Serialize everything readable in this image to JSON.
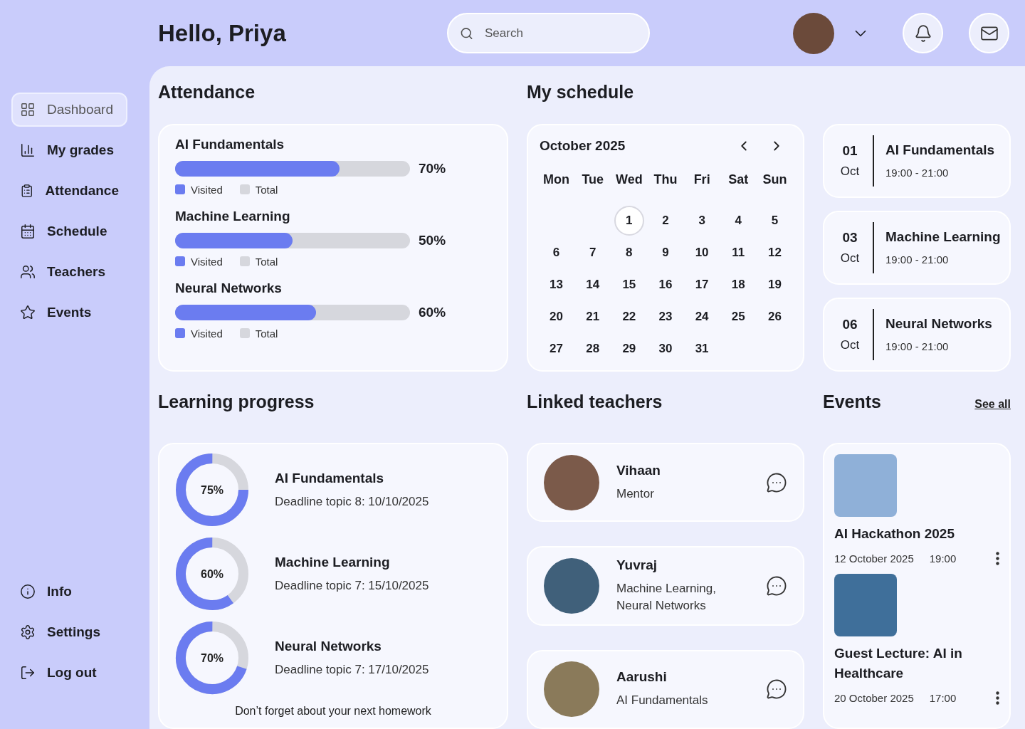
{
  "header": {
    "greeting": "Hello, Priya",
    "search": {
      "placeholder": "Search"
    }
  },
  "sidebar": {
    "items": [
      {
        "label": "Dashboard",
        "selected": true
      },
      {
        "label": "My grades",
        "selected": false
      },
      {
        "label": "Attendance",
        "selected": false
      },
      {
        "label": "Schedule",
        "selected": false
      },
      {
        "label": "Teachers",
        "selected": false
      },
      {
        "label": "Events",
        "selected": false
      }
    ],
    "bottom_items": [
      {
        "label": "Info"
      },
      {
        "label": "Settings"
      },
      {
        "label": "Log out"
      }
    ]
  },
  "attendance": {
    "title": "Attendance",
    "courses": [
      {
        "name": "AI Fundamentals",
        "level": 0.7,
        "percent": "70%",
        "legend": [
          "Visited",
          "Total"
        ]
      },
      {
        "name": "Machine Learning",
        "level": 0.5,
        "percent": "50%",
        "legend": [
          "Visited",
          "Total"
        ]
      },
      {
        "name": "Neural Networks",
        "level": 0.6,
        "percent": "60%",
        "legend": [
          "Visited",
          "Total"
        ]
      }
    ]
  },
  "schedule": {
    "title": "My schedule",
    "month": "October 2025",
    "weekdays": [
      "Mon",
      "Tue",
      "Wed",
      "Thu",
      "Fri",
      "Sat",
      "Sun"
    ],
    "weeks": [
      {
        "days": [
          {
            "day": "1",
            "selected": true
          },
          {
            "day": "2",
            "selected": false
          },
          {
            "day": "3",
            "selected": false
          },
          {
            "day": "4",
            "selected": false
          },
          {
            "day": "5",
            "selected": false
          }
        ]
      },
      {
        "days": [
          {
            "day": "6",
            "selected": false
          },
          {
            "day": "7",
            "selected": false
          },
          {
            "day": "8",
            "selected": false
          },
          {
            "day": "9",
            "selected": false
          },
          {
            "day": "10",
            "selected": false
          },
          {
            "day": "11",
            "selected": false
          },
          {
            "day": "12",
            "selected": false
          }
        ]
      },
      {
        "days": [
          {
            "day": "13",
            "selected": false
          },
          {
            "day": "14",
            "selected": false
          },
          {
            "day": "15",
            "selected": false
          },
          {
            "day": "16",
            "selected": false
          },
          {
            "day": "17",
            "selected": false
          },
          {
            "day": "18",
            "selected": false
          },
          {
            "day": "19",
            "selected": false
          }
        ]
      },
      {
        "days": [
          {
            "day": "20",
            "selected": false
          },
          {
            "day": "21",
            "selected": false
          },
          {
            "day": "22",
            "selected": false
          },
          {
            "day": "23",
            "selected": false
          },
          {
            "day": "24",
            "selected": false
          },
          {
            "day": "25",
            "selected": false
          },
          {
            "day": "26",
            "selected": false
          }
        ]
      },
      {
        "days": [
          {
            "day": "27",
            "selected": false
          },
          {
            "day": "28",
            "selected": false
          },
          {
            "day": "29",
            "selected": false
          },
          {
            "day": "30",
            "selected": false
          },
          {
            "day": "31",
            "selected": false
          }
        ]
      }
    ],
    "lessons": [
      {
        "day": "01",
        "month": "Oct",
        "title": "AI Fundamentals",
        "time": "19:00 - 21:00"
      },
      {
        "day": "03",
        "month": "Oct",
        "title": "Machine Learning",
        "time": "19:00 - 21:00"
      },
      {
        "day": "06",
        "month": "Oct",
        "title": "Neural Networks",
        "time": "19:00 - 21:00"
      }
    ]
  },
  "learning_progress": {
    "title": "Learning progress",
    "courses": [
      {
        "name": "AI Fundamentals",
        "level": 0.75,
        "percent": "75%",
        "deadline": "Deadline topic 8: 10/10/2025"
      },
      {
        "name": "Machine Learning",
        "level": 0.6,
        "percent": "60%",
        "deadline": "Deadline topic 7: 15/10/2025"
      },
      {
        "name": "Neural Networks",
        "level": 0.7,
        "percent": "70%",
        "deadline": "Deadline topic 7: 17/10/2025"
      }
    ],
    "footer": "Don’t forget about your next homework"
  },
  "linked_teachers": {
    "title": "Linked teachers",
    "teachers": [
      {
        "name": "Vihaan",
        "role": "Mentor"
      },
      {
        "name": "Yuvraj",
        "role": "Machine Learning, Neural Networks"
      },
      {
        "name": "Aarushi",
        "role": "AI Fundamentals"
      }
    ]
  },
  "events": {
    "title": "Events",
    "link": "See all",
    "items": [
      {
        "title": "AI Hackathon 2025",
        "date": "12 October 2025",
        "time": "19:00"
      },
      {
        "title": "Guest Lecture: AI in Healthcare",
        "date": "20 October 2025",
        "time": "17:00"
      }
    ]
  }
}
